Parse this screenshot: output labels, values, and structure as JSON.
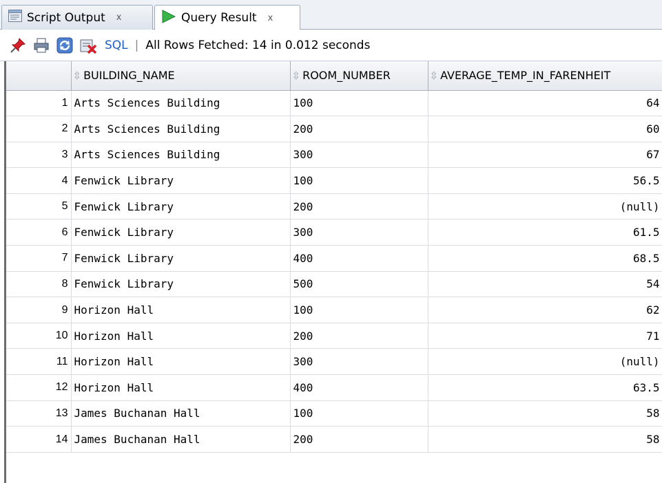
{
  "tabs": [
    {
      "label": "Script Output",
      "close": "x",
      "active": false,
      "icon": "script-output-icon"
    },
    {
      "label": "Query Result",
      "close": "x",
      "active": true,
      "icon": "run-triangle-icon"
    }
  ],
  "toolbar": {
    "icons": [
      "pin-icon",
      "print-icon",
      "refresh-icon",
      "export-icon"
    ],
    "sql_label": "SQL",
    "separator": "|",
    "status": "All Rows Fetched: 14 in 0.012 seconds"
  },
  "columns": [
    "",
    "BUILDING_NAME",
    "ROOM_NUMBER",
    "AVERAGE_TEMP_IN_FARENHEIT"
  ],
  "rows": [
    {
      "n": "1",
      "building": "Arts Sciences Building",
      "room": "100",
      "temp": "64"
    },
    {
      "n": "2",
      "building": "Arts Sciences Building",
      "room": "200",
      "temp": "60"
    },
    {
      "n": "3",
      "building": "Arts Sciences Building",
      "room": "300",
      "temp": "67"
    },
    {
      "n": "4",
      "building": "Fenwick Library",
      "room": "100",
      "temp": "56.5"
    },
    {
      "n": "5",
      "building": "Fenwick Library",
      "room": "200",
      "temp": "(null)"
    },
    {
      "n": "6",
      "building": "Fenwick Library",
      "room": "300",
      "temp": "61.5"
    },
    {
      "n": "7",
      "building": "Fenwick Library",
      "room": "400",
      "temp": "68.5"
    },
    {
      "n": "8",
      "building": "Fenwick Library",
      "room": "500",
      "temp": "54"
    },
    {
      "n": "9",
      "building": "Horizon Hall",
      "room": "100",
      "temp": "62"
    },
    {
      "n": "10",
      "building": "Horizon Hall",
      "room": "200",
      "temp": "71"
    },
    {
      "n": "11",
      "building": "Horizon Hall",
      "room": "300",
      "temp": "(null)"
    },
    {
      "n": "12",
      "building": "Horizon Hall",
      "room": "400",
      "temp": "63.5"
    },
    {
      "n": "13",
      "building": "James Buchanan Hall",
      "room": "100",
      "temp": "58"
    },
    {
      "n": "14",
      "building": "James Buchanan Hall",
      "room": "200",
      "temp": "58"
    }
  ]
}
